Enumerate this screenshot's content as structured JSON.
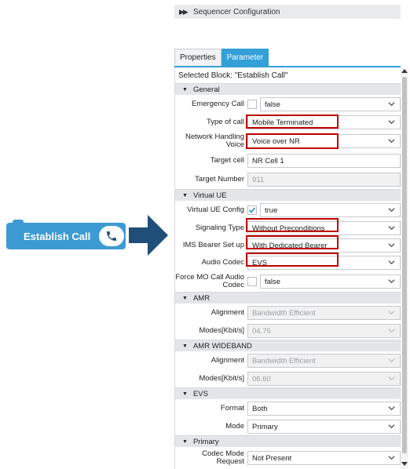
{
  "sequencer": {
    "title": "Sequencer Configuration"
  },
  "tabs": [
    {
      "label": "Properties",
      "active": false
    },
    {
      "label": "Parameter",
      "active": true
    }
  ],
  "selected_block": "Selected Block: \"Establish Call\"",
  "sections": {
    "general": "General",
    "virtual_ue": "Virtual UE",
    "amr": "AMR",
    "amr_wideband": "AMR WIDEBAND",
    "evs": "EVS",
    "primary": "Primary"
  },
  "general": {
    "emergency_call": {
      "label": "Emergency Call",
      "checked": false,
      "value": "false"
    },
    "type_of_call": {
      "label": "Type of call",
      "value": "Mobile Terminated"
    },
    "network_handling_voice": {
      "label_line1": "Network Handling",
      "label_line2": "Voice",
      "value": "Voice over NR"
    },
    "target_cell": {
      "label": "Target cell",
      "value": "NR Cell 1"
    },
    "target_number": {
      "label": "Target Number",
      "value": "911"
    }
  },
  "virtual_ue": {
    "config": {
      "label": "Virtual UE Config",
      "checked": true,
      "value": "true"
    },
    "signaling_type": {
      "label": "Signaling Type",
      "value": "Without Preconditions"
    },
    "ims_bearer": {
      "label": "IMS Bearer Set up",
      "value": "With Dedicated Bearer"
    },
    "audio_codec": {
      "label": "Audio Codec",
      "value": "EVS"
    },
    "force_mo": {
      "label_line1": "Force MO Call Audio",
      "label_line2": "Codec",
      "checked": false,
      "value": "false"
    }
  },
  "amr": {
    "alignment": {
      "label": "Alignment",
      "value": "Bandwidth Efficient"
    },
    "modes": {
      "label": "Modes[Kbit/s]",
      "value": "04.75"
    }
  },
  "amr_wideband": {
    "alignment": {
      "label": "Alignment",
      "value": "Bandwidth Efficient"
    },
    "modes": {
      "label": "Modes[Kbit/s]",
      "value": "06.60"
    }
  },
  "evs": {
    "format": {
      "label": "Format",
      "value": "Both"
    },
    "mode": {
      "label": "Mode",
      "value": "Primary"
    }
  },
  "primary": {
    "codec_mode_request": {
      "label_line1": "Codec Mode",
      "label_line2": "Request",
      "value": "Not Present"
    }
  },
  "block": {
    "label": "Establish Call",
    "color": "#3d9bd4"
  },
  "colors": {
    "accent": "#33a0d7",
    "highlight": "#c00000",
    "arrow": "#1f4e79"
  }
}
